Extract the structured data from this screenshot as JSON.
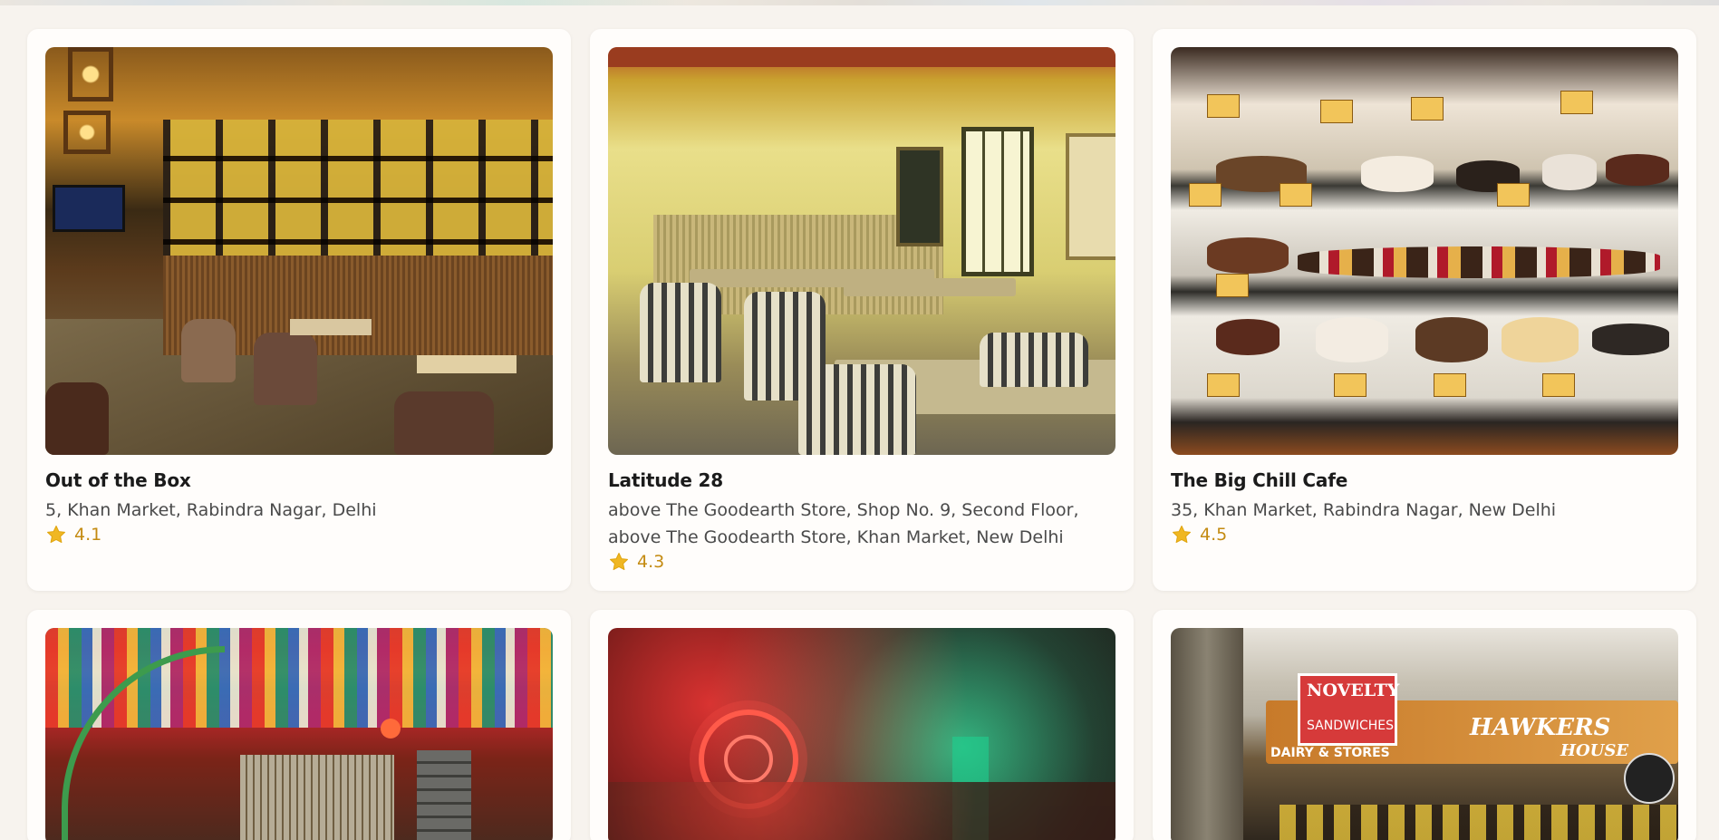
{
  "restaurants": [
    {
      "name": "Out of the Box",
      "address": "5, Khan Market, Rabindra Nagar, Delhi",
      "rating": "4.1",
      "image_icon": "cafe-interior-photo"
    },
    {
      "name": "Latitude 28",
      "address": "above The Goodearth Store, Shop No. 9, Second Floor, above The Goodearth Store, Khan Market, New Delhi",
      "rating": "4.3",
      "image_icon": "dining-room-photo"
    },
    {
      "name": "The Big Chill Cafe",
      "address": "35, Khan Market, Rabindra Nagar, New Delhi",
      "rating": "4.5",
      "image_icon": "bakery-display-photo"
    }
  ],
  "row2_images": [
    {
      "image_icon": "colorful-flags-restaurant-photo"
    },
    {
      "image_icon": "red-green-lit-garden-photo"
    },
    {
      "image_icon": "storefront-signs-photo",
      "sign_texts": [
        "NOVELTY",
        "SANDWICHES",
        "HAWKERS",
        "HOUSE",
        "DAIRY & STORES"
      ]
    }
  ],
  "colors": {
    "page_background": "#f7f3ee",
    "card_background": "#fffdfb",
    "rating_color": "#c48b12",
    "star_color": "#f0b722"
  }
}
